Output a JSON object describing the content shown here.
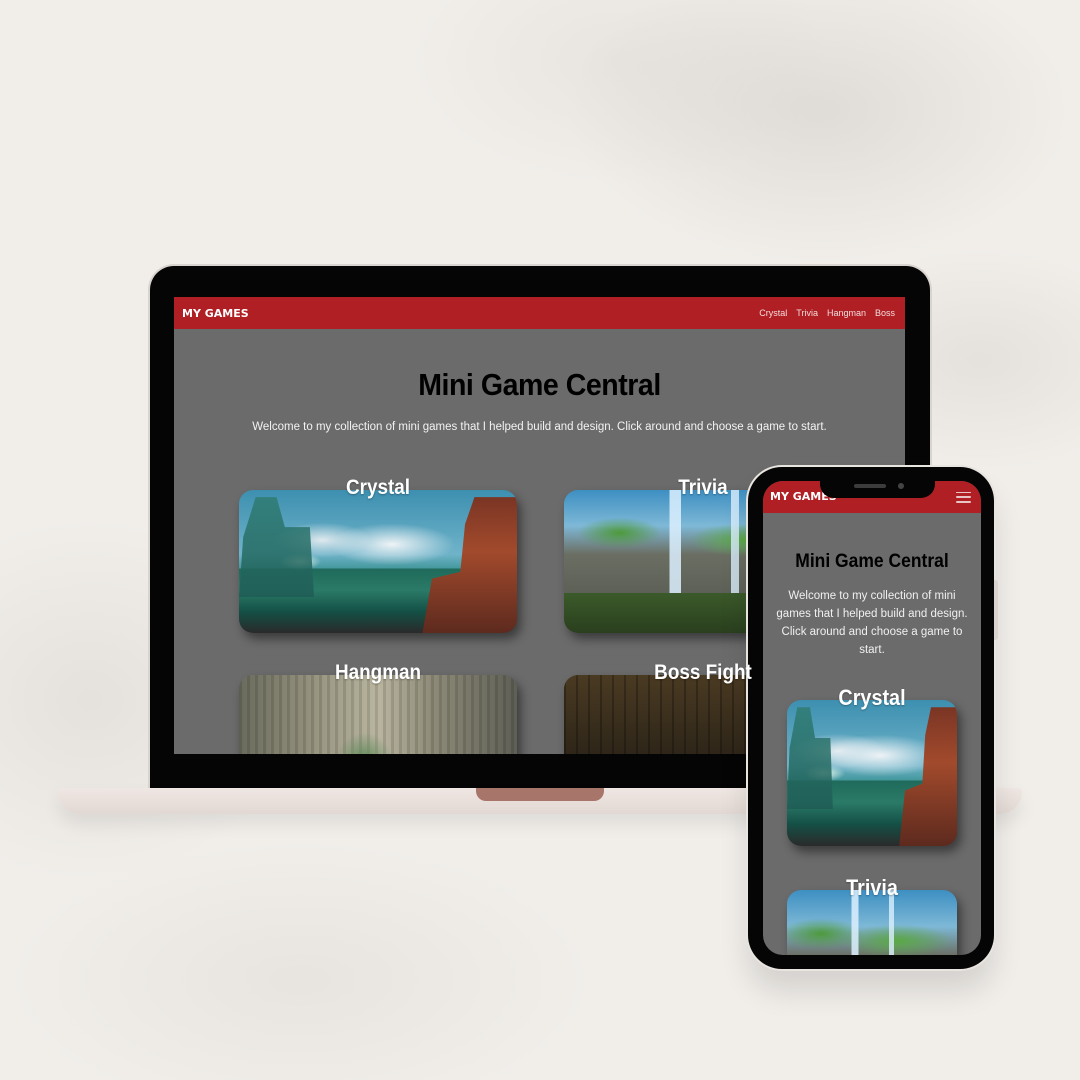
{
  "desktop": {
    "brand": "MY GAMES",
    "nav_links": [
      "Crystal",
      "Trivia",
      "Hangman",
      "Boss"
    ],
    "hero_title": "Mini Game Central",
    "hero_text": "Welcome to my collection of mini games that I helped build and design. Click around and choose a game to start.",
    "cards": [
      {
        "title": "Crystal"
      },
      {
        "title": "Trivia"
      },
      {
        "title": "Hangman"
      },
      {
        "title": "Boss Fight"
      }
    ]
  },
  "mobile": {
    "brand": "MY GAMES",
    "hero_title": "Mini Game Central",
    "hero_text": "Welcome to my collection of mini games that I helped build and design. Click around and choose a game to start.",
    "cards": [
      {
        "title": "Crystal"
      },
      {
        "title": "Trivia"
      }
    ]
  },
  "colors": {
    "navbar": "#b01f24",
    "page_background": "#6b6b6b",
    "backdrop": "#f1eeea"
  }
}
